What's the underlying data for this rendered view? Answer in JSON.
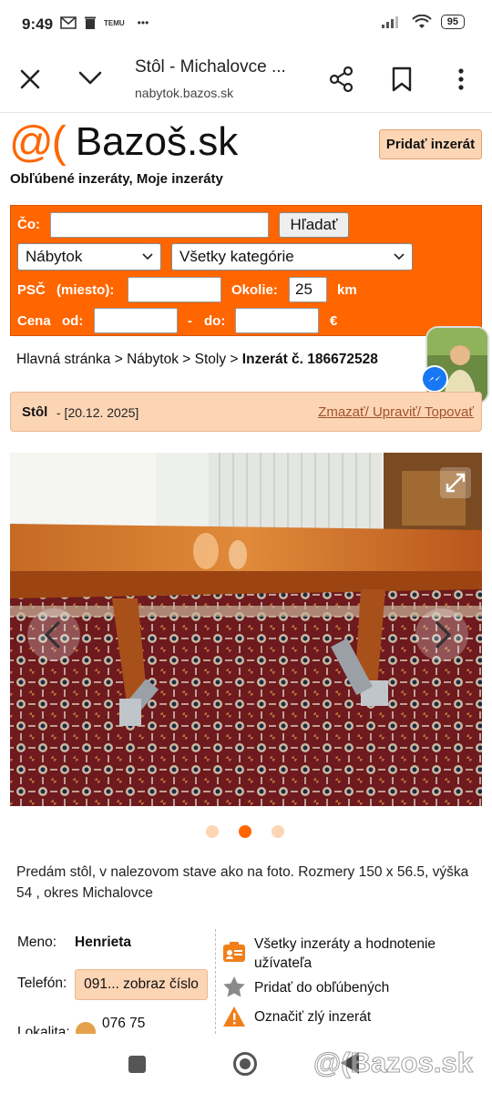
{
  "status_bar": {
    "time": "9:49",
    "icons": [
      "gmail-icon",
      "trash-icon",
      "temu-icon",
      "more-dots-icon"
    ],
    "temu_label": "TEMU",
    "more": "•••",
    "battery": "95"
  },
  "browser": {
    "title": "Stôl - Michalovce ...",
    "url": "nabytok.bazos.sk"
  },
  "header": {
    "logo_symbol": "@(",
    "logo_text": "Bazoš.sk",
    "add_button": "Pridať inzerát",
    "links": "Obľúbené inzeráty, Moje inzeráty"
  },
  "search": {
    "co_label": "Čo:",
    "co_value": "",
    "search_button": "Hľadať",
    "section_select": "Nábytok",
    "category_select": "Všetky kategórie",
    "psc_label": "PSČ",
    "miesto_label": "(miesto):",
    "psc_value": "",
    "okolie_label": "Okolie:",
    "okolie_value": "25",
    "km_label": "km",
    "cena_label": "Cena",
    "od_label": "od:",
    "od_value": "",
    "dash": "-",
    "do_label": "do:",
    "do_value": "",
    "currency": "€"
  },
  "breadcrumb": {
    "home": "Hlavná stránka",
    "sep": ">",
    "section": "Nábytok",
    "category": "Stoly",
    "current": "Inzerát č. 186672528"
  },
  "listing": {
    "name": "Stôl",
    "date": "- [20.12. 2025]",
    "actions": "Zmazať/ Upraviť/ Topovať",
    "description": "Predám stôl, v nalezovom stave ako na foto. Rozmery 150 x 56.5, výška 54 , okres Michalovce",
    "photo_count": 3,
    "active_photo": 2
  },
  "seller": {
    "name_label": "Meno:",
    "name": "Henrieta",
    "phone_label": "Telefón:",
    "phone_button": "091... zobraz číslo",
    "location_label": "Lokalita:",
    "location_value": "076 75",
    "all_ads": "Všetky inzeráty a hodnotenie užívateľa",
    "add_favorite": "Pridať do obľúbených",
    "report": "Označiť zlý inzerát"
  },
  "watermark": "@(Bazos.sk",
  "colors": {
    "brand_orange": "#ff6600",
    "button_peach": "#fcd5b5",
    "link_brown": "#a0522d"
  }
}
